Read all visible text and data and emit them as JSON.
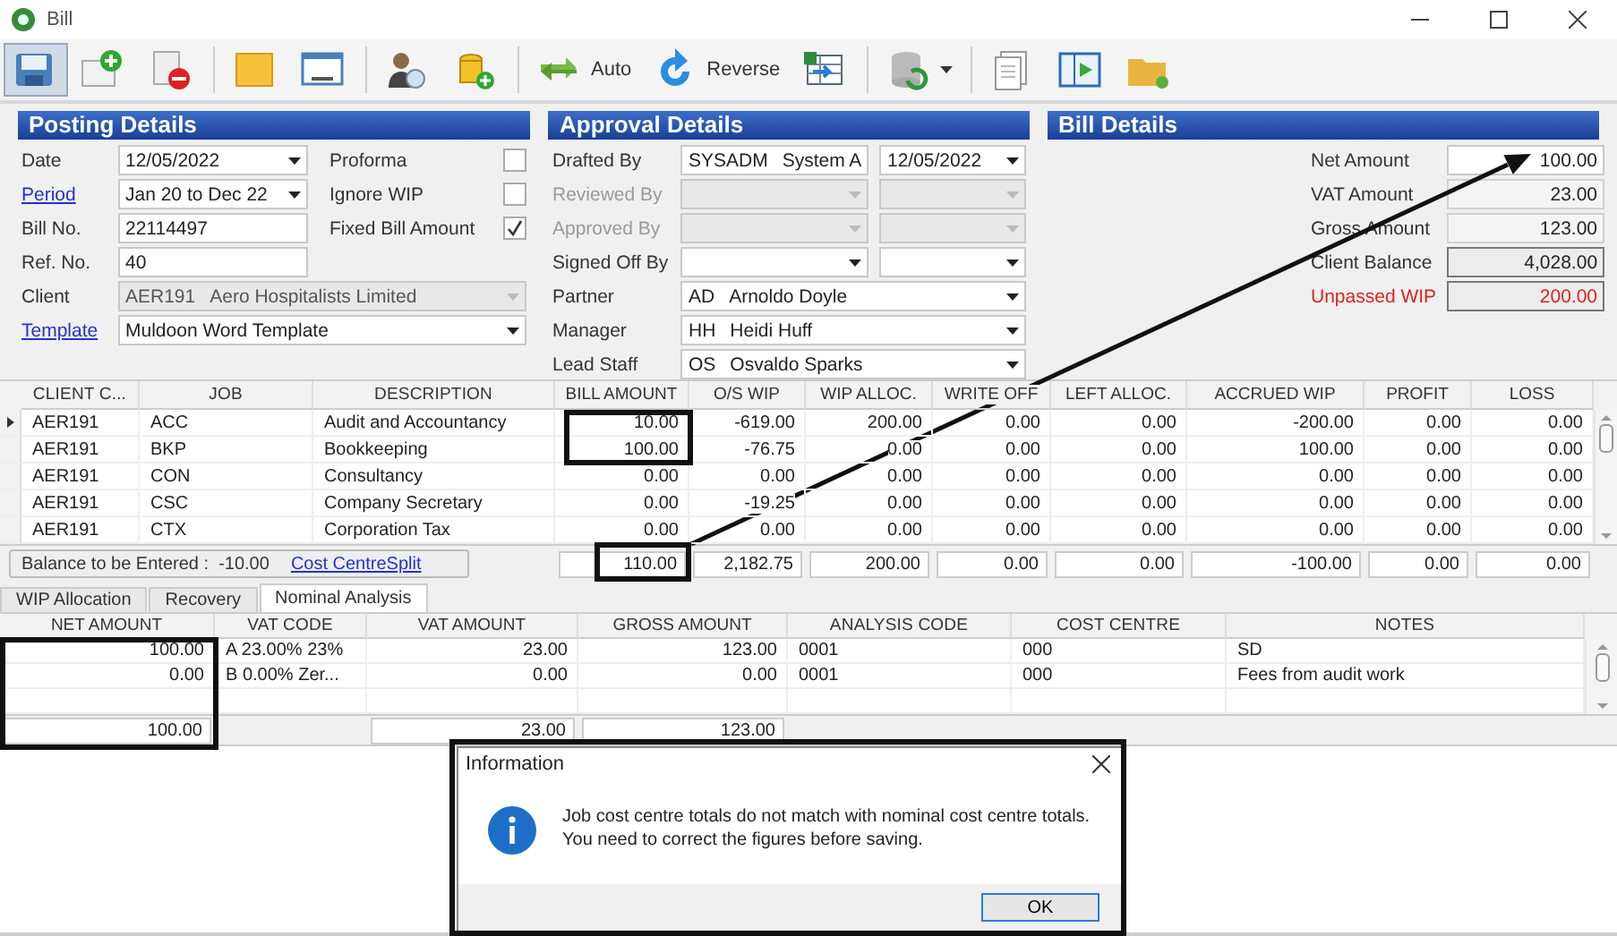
{
  "window": {
    "title": "Bill"
  },
  "toolbar": [
    {
      "kind": "save",
      "pressed": true
    },
    {
      "kind": "add",
      "pressed": false
    },
    {
      "kind": "delete",
      "pressed": false
    },
    {
      "kind": "separator"
    },
    {
      "kind": "note",
      "pressed": false
    },
    {
      "kind": "window-link",
      "pressed": false
    },
    {
      "kind": "separator"
    },
    {
      "kind": "person-clock",
      "pressed": false
    },
    {
      "kind": "coins",
      "pressed": false
    },
    {
      "kind": "separator"
    },
    {
      "kind": "swap",
      "label": "Auto",
      "pressed": false
    },
    {
      "kind": "reverse",
      "label": "Reverse",
      "pressed": false
    },
    {
      "kind": "sheet",
      "pressed": false
    },
    {
      "kind": "separator"
    },
    {
      "kind": "database-menu",
      "pressed": false
    },
    {
      "kind": "separator"
    },
    {
      "kind": "document",
      "pressed": false
    },
    {
      "kind": "panel",
      "pressed": false
    },
    {
      "kind": "folder",
      "pressed": false
    }
  ],
  "posting_details": {
    "title": "Posting Details",
    "fields": [
      {
        "label": "Date",
        "link": false,
        "value": "12/05/2022",
        "kind": "dropdown",
        "disabled": false
      },
      {
        "label": "Period",
        "link": true,
        "value": "Jan 20 to Dec 22",
        "kind": "dropdown",
        "disabled": false
      },
      {
        "label": "Bill No.",
        "link": false,
        "value": "22114497",
        "kind": "text",
        "disabled": false
      },
      {
        "label": "Ref. No.",
        "link": false,
        "value": "40",
        "kind": "text",
        "disabled": false
      },
      {
        "label": "Client",
        "link": false,
        "code": "AER191",
        "value": "Aero Hospitalists Limited",
        "kind": "dropdown",
        "disabled": true
      },
      {
        "label": "Template",
        "link": true,
        "value": "Muldoon Word Template",
        "kind": "dropdown",
        "disabled": false
      }
    ],
    "options": [
      {
        "label": "Proforma",
        "checked": false
      },
      {
        "label": "Ignore WIP",
        "checked": false
      },
      {
        "label": "Fixed Bill Amount",
        "checked": true
      }
    ]
  },
  "approval_details": {
    "title": "Approval Details",
    "rows": [
      {
        "label": "Drafted By",
        "disabled": false,
        "code": "SYSADM",
        "name": "System A",
        "date": "12/05/2022"
      },
      {
        "label": "Reviewed By",
        "disabled": true
      },
      {
        "label": "Approved By",
        "disabled": true
      },
      {
        "label": "Signed Off By",
        "disabled": false
      },
      {
        "label": "Partner",
        "disabled": false,
        "code": "AD",
        "name": "Arnoldo Doyle",
        "wide": true
      },
      {
        "label": "Manager",
        "disabled": false,
        "code": "HH",
        "name": "Heidi Huff",
        "wide": true
      },
      {
        "label": "Lead Staff",
        "disabled": false,
        "code": "OS",
        "name": "Osvaldo Sparks",
        "wide": true
      }
    ]
  },
  "bill_details": {
    "title": "Bill Details",
    "fields": [
      {
        "label": "Net Amount",
        "value": "100.00",
        "kind": "input",
        "alert": false
      },
      {
        "label": "VAT Amount",
        "value": "23.00",
        "kind": "calculated",
        "alert": false
      },
      {
        "label": "Gross Amount",
        "value": "123.00",
        "kind": "calculated",
        "alert": false
      },
      {
        "label": "Client Balance",
        "value": "4,028.00",
        "kind": "readonly",
        "alert": false
      },
      {
        "label": "Unpassed WIP",
        "value": "200.00",
        "kind": "readonly",
        "alert": true
      }
    ]
  },
  "jobs_table": {
    "columns": [
      {
        "label": "CLIENT C...",
        "numeric": false
      },
      {
        "label": "JOB",
        "numeric": false
      },
      {
        "label": "DESCRIPTION",
        "numeric": false
      },
      {
        "label": "BILL AMOUNT",
        "numeric": true
      },
      {
        "label": "O/S WIP",
        "numeric": true
      },
      {
        "label": "WIP ALLOC.",
        "numeric": true
      },
      {
        "label": "WRITE OFF",
        "numeric": true
      },
      {
        "label": "LEFT ALLOC.",
        "numeric": true
      },
      {
        "label": "ACCRUED WIP",
        "numeric": true
      },
      {
        "label": "PROFIT",
        "numeric": true
      },
      {
        "label": "LOSS",
        "numeric": true
      }
    ],
    "rows": [
      {
        "selected": true,
        "cells": [
          "AER191",
          "ACC",
          "Audit and Accountancy",
          "10.00",
          "-619.00",
          "200.00",
          "0.00",
          "0.00",
          "-200.00",
          "0.00",
          "0.00"
        ]
      },
      {
        "selected": false,
        "cells": [
          "AER191",
          "BKP",
          "Bookkeeping",
          "100.00",
          "-76.75",
          "0.00",
          "0.00",
          "0.00",
          "100.00",
          "0.00",
          "0.00"
        ]
      },
      {
        "selected": false,
        "cells": [
          "AER191",
          "CON",
          "Consultancy",
          "0.00",
          "0.00",
          "0.00",
          "0.00",
          "0.00",
          "0.00",
          "0.00",
          "0.00"
        ]
      },
      {
        "selected": false,
        "cells": [
          "AER191",
          "CSC",
          "Company Secretary",
          "0.00",
          "-19.25",
          "0.00",
          "0.00",
          "0.00",
          "0.00",
          "0.00",
          "0.00"
        ]
      },
      {
        "selected": false,
        "cells": [
          "AER191",
          "CTX",
          "Corporation Tax",
          "0.00",
          "0.00",
          "0.00",
          "0.00",
          "0.00",
          "0.00",
          "0.00",
          "0.00"
        ]
      }
    ],
    "balance_label": "Balance to be Entered :  -10.00",
    "split_link": "Cost CentreSplit",
    "totals": [
      "110.00",
      "2,182.75",
      "200.00",
      "0.00",
      "0.00",
      "-100.00",
      "0.00",
      "0.00"
    ]
  },
  "tabs": [
    {
      "label": "WIP Allocation",
      "selected": false
    },
    {
      "label": "Recovery",
      "selected": false
    },
    {
      "label": "Nominal Analysis",
      "selected": true
    }
  ],
  "nominal_table": {
    "columns": [
      {
        "label": "NET AMOUNT",
        "numeric": true
      },
      {
        "label": "VAT CODE",
        "numeric": false
      },
      {
        "label": "VAT AMOUNT",
        "numeric": true
      },
      {
        "label": "GROSS AMOUNT",
        "numeric": true
      },
      {
        "label": "ANALYSIS CODE",
        "numeric": false
      },
      {
        "label": "COST CENTRE",
        "numeric": false
      },
      {
        "label": "NOTES",
        "numeric": false
      }
    ],
    "rows": [
      {
        "cells": [
          "100.00",
          "A 23.00%  23%",
          "23.00",
          "123.00",
          "0001",
          "000",
          "SD"
        ]
      },
      {
        "cells": [
          "0.00",
          "B 0.00%  Zer...",
          "0.00",
          "0.00",
          "0001",
          "000",
          "Fees from audit work"
        ]
      }
    ],
    "totals": {
      "net_amount": "100.00",
      "vat_amount": "23.00",
      "gross_amount": "123.00"
    }
  },
  "dialog": {
    "title": "Information",
    "message": "Job cost centre totals do not match with nominal cost centre totals.",
    "note": "You need to correct the figures before saving.",
    "button": "OK"
  },
  "annotations": [
    {
      "kind": "box"
    },
    {
      "kind": "box"
    },
    {
      "kind": "box"
    },
    {
      "kind": "box"
    },
    {
      "kind": "arrow"
    }
  ]
}
